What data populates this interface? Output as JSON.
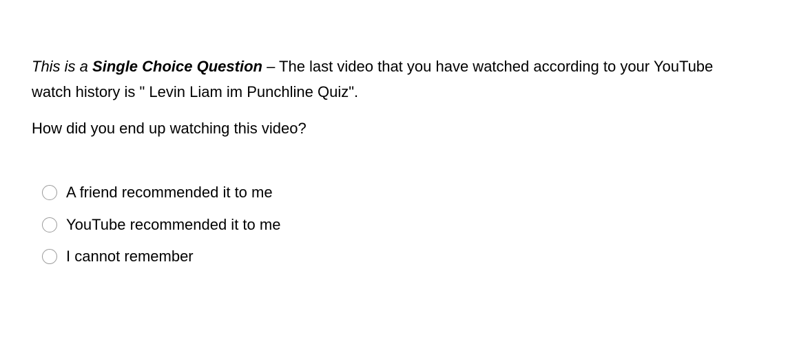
{
  "question": {
    "intro_italic": "This is a ",
    "intro_bold": "Single Choice Question",
    "intro_rest": " – The last video that you have watched according to your YouTube watch history is \" Levin Liam im Punchline Quiz\".",
    "prompt": "How did you end up watching this video?"
  },
  "options": [
    {
      "label": "A friend recommended it to me",
      "selected": false
    },
    {
      "label": "YouTube recommended it to me",
      "selected": false
    },
    {
      "label": "I cannot remember",
      "selected": false
    }
  ]
}
